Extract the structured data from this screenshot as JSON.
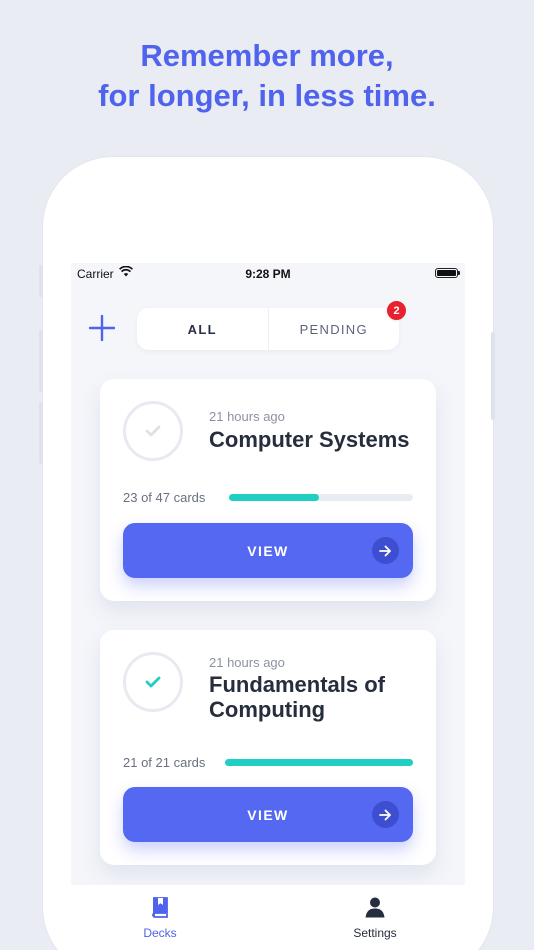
{
  "promo": {
    "line1": "Remember more,",
    "line2": "for longer, in less time."
  },
  "status_bar": {
    "carrier": "Carrier",
    "time": "9:28 PM"
  },
  "header": {
    "add_icon": "plus-icon",
    "tabs": [
      {
        "label": "ALL",
        "active": true
      },
      {
        "label": "PENDING",
        "active": false
      }
    ],
    "pending_badge": "2"
  },
  "decks": [
    {
      "updated": "21 hours ago",
      "title": "Computer Systems",
      "count_text": "23 of 47 cards",
      "progress": 0.49,
      "completed": false,
      "view_label": "VIEW"
    },
    {
      "updated": "21 hours ago",
      "title": "Fundamentals of Computing",
      "count_text": "21 of 21 cards",
      "progress": 1.0,
      "completed": true,
      "view_label": "VIEW"
    }
  ],
  "tab_bar": {
    "items": [
      {
        "label": "Decks",
        "icon": "book-icon",
        "active": true
      },
      {
        "label": "Settings",
        "icon": "user-icon",
        "active": false
      }
    ]
  },
  "colors": {
    "accent": "#4f63ec",
    "button": "#5568f1",
    "progress": "#1fcfc3",
    "badge": "#e8212e"
  }
}
